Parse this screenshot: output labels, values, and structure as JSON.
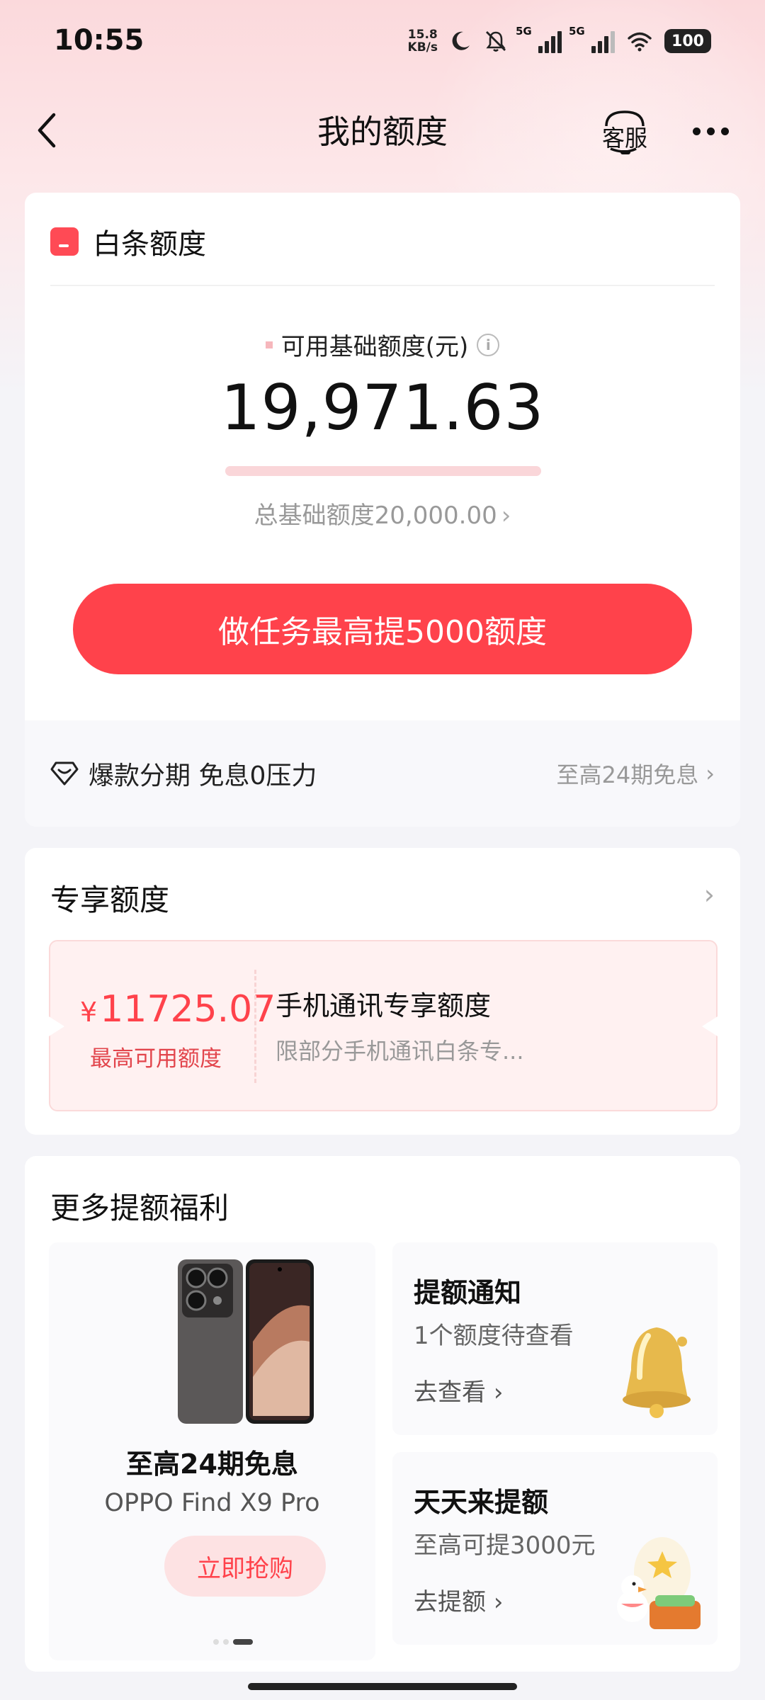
{
  "status_bar": {
    "time": "10:55",
    "net_speed_value": "15.8",
    "net_speed_unit": "KB/s",
    "sim1_label": "5G",
    "sim2_label": "5G",
    "battery": "100"
  },
  "header": {
    "title": "我的额度",
    "service_label": "客服"
  },
  "baitiao": {
    "title": "白条额度",
    "available_label": "可用基础额度(元)",
    "available_amount": "19,971.63",
    "usage_fraction_available": 0.9986,
    "total_label": "总基础额度20,000.00",
    "task_button": "做任务最高提5000额度",
    "installment_text": "爆款分期 免息0压力",
    "installment_right": "至高24期免息"
  },
  "exclusive": {
    "title": "专享额度",
    "currency": "¥",
    "amount": "11725.07",
    "amount_label": "最高可用额度",
    "name": "手机通讯专享额度",
    "desc": "限部分手机通讯白条专..."
  },
  "more": {
    "title": "更多提额福利",
    "promo": {
      "title": "至高24期免息",
      "product": "OPPO Find X9 Pro",
      "button": "立即抢购"
    },
    "notice": {
      "title": "提额通知",
      "sub": "1个额度待查看",
      "link": "去查看"
    },
    "daily": {
      "title": "天天来提额",
      "sub": "至高可提3000元",
      "link": "去提额"
    }
  },
  "colors": {
    "accent": "#ff424b",
    "accent_light": "#fde2e3",
    "progress": "#fad6d9"
  }
}
